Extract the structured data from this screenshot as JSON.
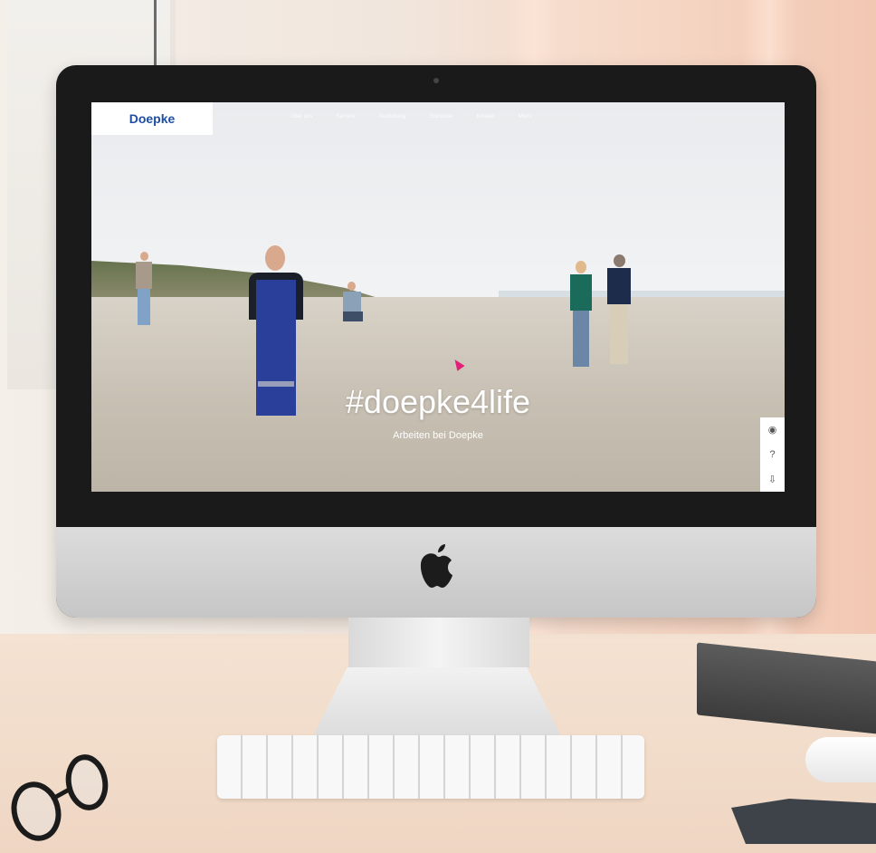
{
  "site": {
    "logo": "Doepke",
    "nav_items": [
      "Über uns",
      "Karriere",
      "Ausbildung",
      "Standorte",
      "Kontakt",
      "Menü"
    ],
    "hero_title": "#doepke4life",
    "hero_subtitle": "Arbeiten bei Doepke",
    "side_label": "",
    "side_buttons": [
      "◉",
      "?",
      "⇩"
    ]
  },
  "colors": {
    "brand_blue": "#1f4ea3",
    "cursor_pink": "#e2207a",
    "monitor_black": "#1a1a1a"
  },
  "icons": {
    "apple_logo": "apple-logo-icon",
    "cursor": "mouse-cursor-icon"
  }
}
